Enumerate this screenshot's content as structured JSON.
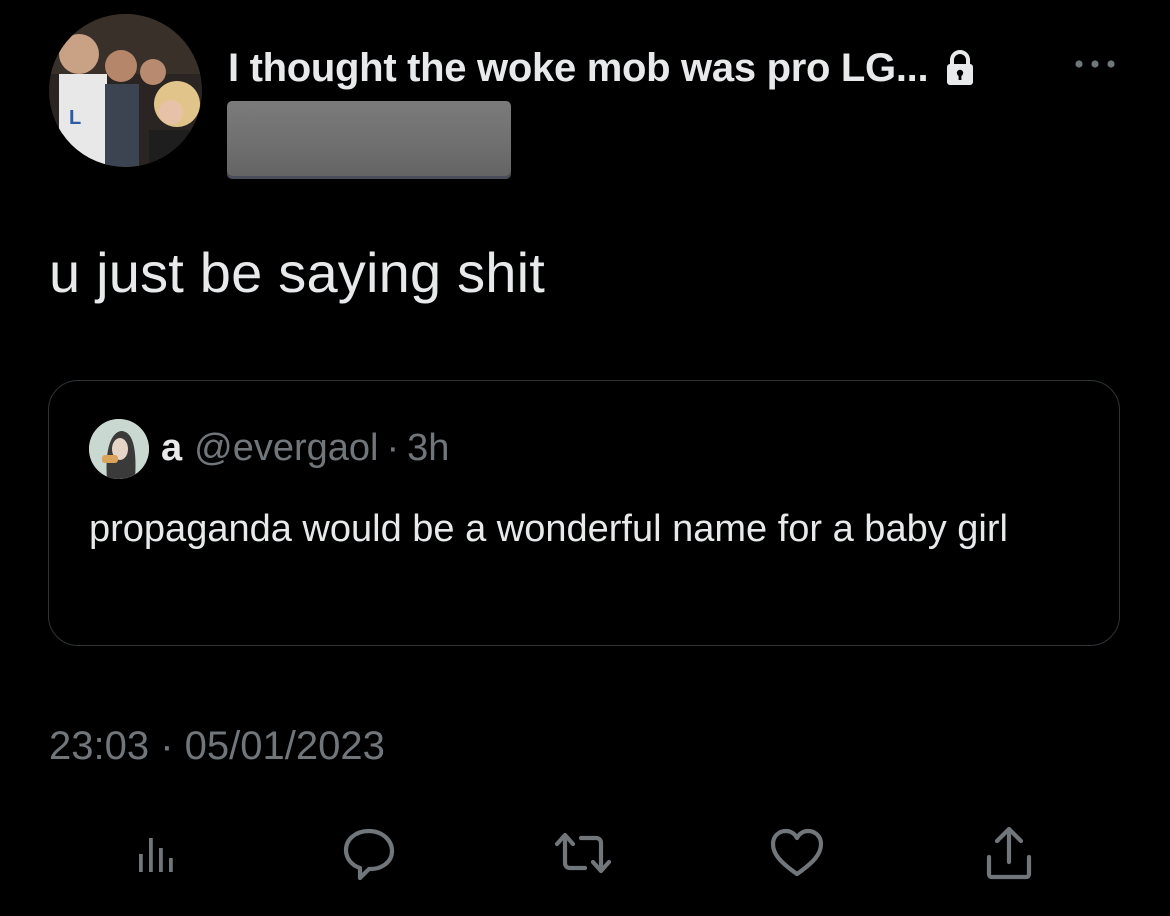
{
  "tweet": {
    "author": {
      "display_name": "I thought the woke mob was pro LG...",
      "protected_icon": "lock-icon",
      "avatar": "profile-photo"
    },
    "more_icon": "more-horizontal-icon",
    "text": "u just be saying shit",
    "quoted": {
      "name": "a",
      "handle": "@evergaol",
      "separator": "·",
      "time": "3h",
      "text": "propaganda would be a wonderful name for a baby girl"
    },
    "timestamp": "23:03 · 05/01/2023",
    "actions": [
      {
        "name": "views",
        "icon": "analytics-icon"
      },
      {
        "name": "reply",
        "icon": "reply-icon"
      },
      {
        "name": "retweet",
        "icon": "retweet-icon"
      },
      {
        "name": "like",
        "icon": "heart-icon"
      },
      {
        "name": "share",
        "icon": "share-icon"
      }
    ]
  },
  "colors": {
    "background": "#000000",
    "primary_text": "#e7e9ea",
    "secondary_text": "#71767b",
    "border": "#2f3336",
    "redaction": "#737373"
  }
}
